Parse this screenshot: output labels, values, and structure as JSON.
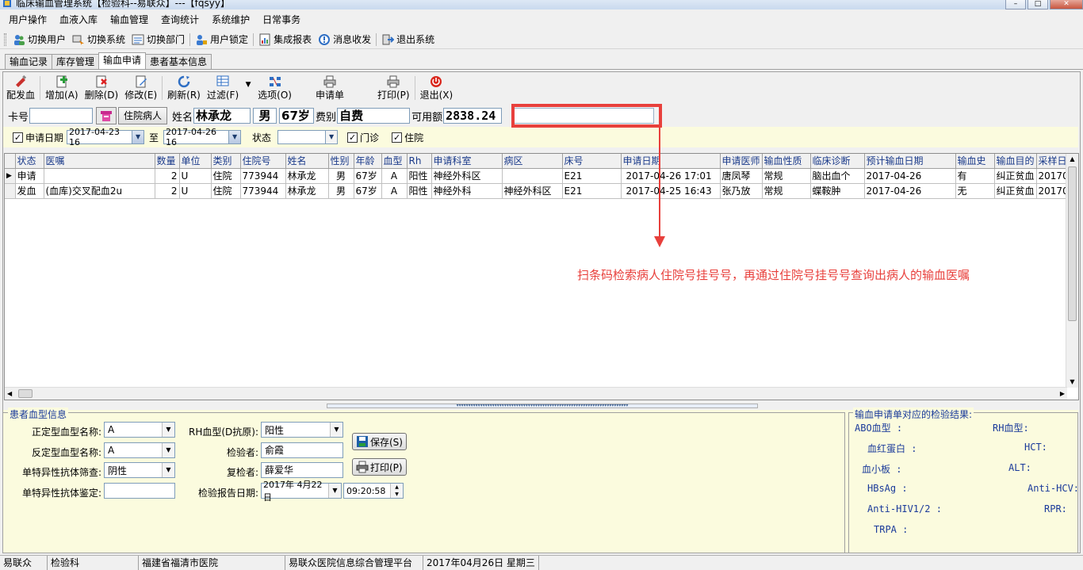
{
  "window": {
    "title": "临床输血管理系统【检验科--易联众】---【fqsyy】"
  },
  "menu": [
    "用户操作",
    "血液入库",
    "输血管理",
    "查询统计",
    "系统维护",
    "日常事务"
  ],
  "toolbar1": [
    {
      "label": "切换用户",
      "icon": "users-icon"
    },
    {
      "label": "切换系统",
      "icon": "switch-system-icon"
    },
    {
      "label": "切换部门",
      "icon": "department-icon"
    },
    {
      "label": "用户锁定",
      "icon": "lock-user-icon"
    },
    {
      "label": "集成报表",
      "icon": "report-icon"
    },
    {
      "label": "消息收发",
      "icon": "message-icon"
    },
    {
      "label": "退出系统",
      "icon": "exit-icon"
    }
  ],
  "tabs": [
    "输血记录",
    "库存管理",
    "输血申请",
    "患者基本信息"
  ],
  "active_tab": "输血申请",
  "toolbar2": [
    {
      "label": "配发血",
      "icon": "dispense-icon"
    },
    {
      "label": "增加(A)",
      "icon": "add-icon"
    },
    {
      "label": "删除(D)",
      "icon": "delete-icon"
    },
    {
      "label": "修改(E)",
      "icon": "edit-icon"
    },
    {
      "label": "刷新(R)",
      "icon": "refresh-icon"
    },
    {
      "label": "过滤(F)",
      "icon": "filter-icon"
    },
    {
      "label": "选项(O)",
      "icon": "options-icon"
    },
    {
      "label": "申请单",
      "icon": "print-form-icon"
    },
    {
      "label": "打印(P)",
      "icon": "print-icon"
    },
    {
      "label": "退出(X)",
      "icon": "power-icon"
    }
  ],
  "patient": {
    "card_label": "卡号",
    "card_value": "",
    "inpatient_button": "住院病人",
    "name_label": "姓名",
    "name": "林承龙",
    "sex": "男",
    "age": "67岁",
    "fee_label": "费别",
    "fee_type": "自费",
    "balance_label": "可用额",
    "balance": "2838.24",
    "barcode_value": ""
  },
  "filter": {
    "apply_date_label": "申请日期",
    "date_from": "2017-04-23 16",
    "to_label": "至",
    "date_to": "2017-04-26 16",
    "status_label": "状态",
    "status_value": "",
    "outpatient_label": "门诊",
    "inpatient_label": "住院"
  },
  "grid": {
    "columns": [
      "状态",
      "医嘱",
      "数量",
      "单位",
      "类别",
      "住院号",
      "姓名",
      "性别",
      "年龄",
      "血型",
      "Rh",
      "申请科室",
      "病区",
      "床号",
      "申请日期",
      "申请医师",
      "输血性质",
      "临床诊断",
      "预计输血日期",
      "输血史",
      "输血目的",
      "采样日"
    ],
    "rows": [
      [
        "申请",
        "",
        "2",
        "U",
        "住院",
        "773944",
        "林承龙",
        "男",
        "67岁",
        "A",
        "阳性",
        "神经外科区",
        "",
        "E21",
        "2017-04-26 17:01",
        "唐凤琴",
        "常规",
        "脑出血个",
        "2017-04-26",
        "有",
        "纠正贫血",
        "20170"
      ],
      [
        "发血",
        "(血库)交叉配血2u",
        "2",
        "U",
        "住院",
        "773944",
        "林承龙",
        "男",
        "67岁",
        "A",
        "阳性",
        "神经外科",
        "神经外科区",
        "E21",
        "2017-04-25 16:43",
        "张乃放",
        "常规",
        "蝶鞍肿",
        "2017-04-26",
        "无",
        "纠正贫血",
        "20170"
      ]
    ]
  },
  "annotation": {
    "text": "扫条码检索病人住院号挂号号，再通过住院号挂号号查询出病人的输血医嘱",
    "color": "#e8403c"
  },
  "blood_info": {
    "title": "患者血型信息",
    "forward_label": "正定型血型名称:",
    "forward_value": "A",
    "reverse_label": "反定型血型名称:",
    "reverse_value": "A",
    "screen_label": "单特异性抗体筛查:",
    "screen_value": "阴性",
    "ident_label": "单特异性抗体鉴定:",
    "ident_value": "",
    "rh_label": "RH血型(D抗原):",
    "rh_value": "阳性",
    "inspector_label": "检验者:",
    "inspector_value": "俞霞",
    "reviewer_label": "复检者:",
    "reviewer_value": "薛爱华",
    "report_date_label": "检验报告日期:",
    "report_date": "2017年 4月22日",
    "report_time": "09:20:58",
    "save_button": "保存(S)",
    "print_button": "打印(P)"
  },
  "results": {
    "title": "输血申请单对应的检验结果:",
    "abo": "ABO血型 :",
    "rh": "RH血型:",
    "hb": "血红蛋白 :",
    "hct": "HCT:",
    "plt": "血小板 :",
    "alt": "ALT:",
    "hbsag": "HBsAg :",
    "hcv": "Anti-HCV:",
    "hiv": "Anti-HIV1/2 :",
    "rpr": "RPR:",
    "trpa": "TRPA :"
  },
  "status_bar": [
    "易联众",
    "检验科",
    "福建省福清市医院",
    "易联众医院信息综合管理平台",
    "2017年04月26日 星期三"
  ]
}
